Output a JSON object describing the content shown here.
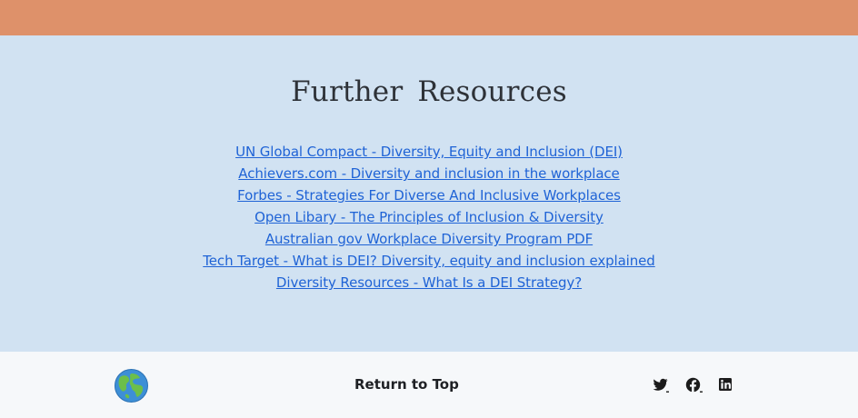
{
  "header": {
    "band_color": "#de916a"
  },
  "resources": {
    "title": "Further  Resources",
    "links": [
      "UN Global Compact - Diversity, Equity and Inclusion (DEI)",
      "Achievers.com - Diversity and inclusion in the workplace",
      "Forbes - Strategies For Diverse And Inclusive Workplaces",
      "Open Libary - The Principles of Inclusion & Diversity",
      "Australian gov Workplace Diversity Program PDF",
      "Tech Target - What is DEI? Diversity, equity and inclusion explained",
      "Diversity Resources - What Is a DEI Strategy?"
    ],
    "background_color": "#d1e2f2",
    "link_color": "#1f63d6"
  },
  "footer": {
    "logo_icon": "globe-icon",
    "return_label": "Return to Top",
    "social_icons": [
      "twitter-icon",
      "facebook-icon",
      "linkedin-icon"
    ],
    "background_color": "#f6f8fa"
  }
}
